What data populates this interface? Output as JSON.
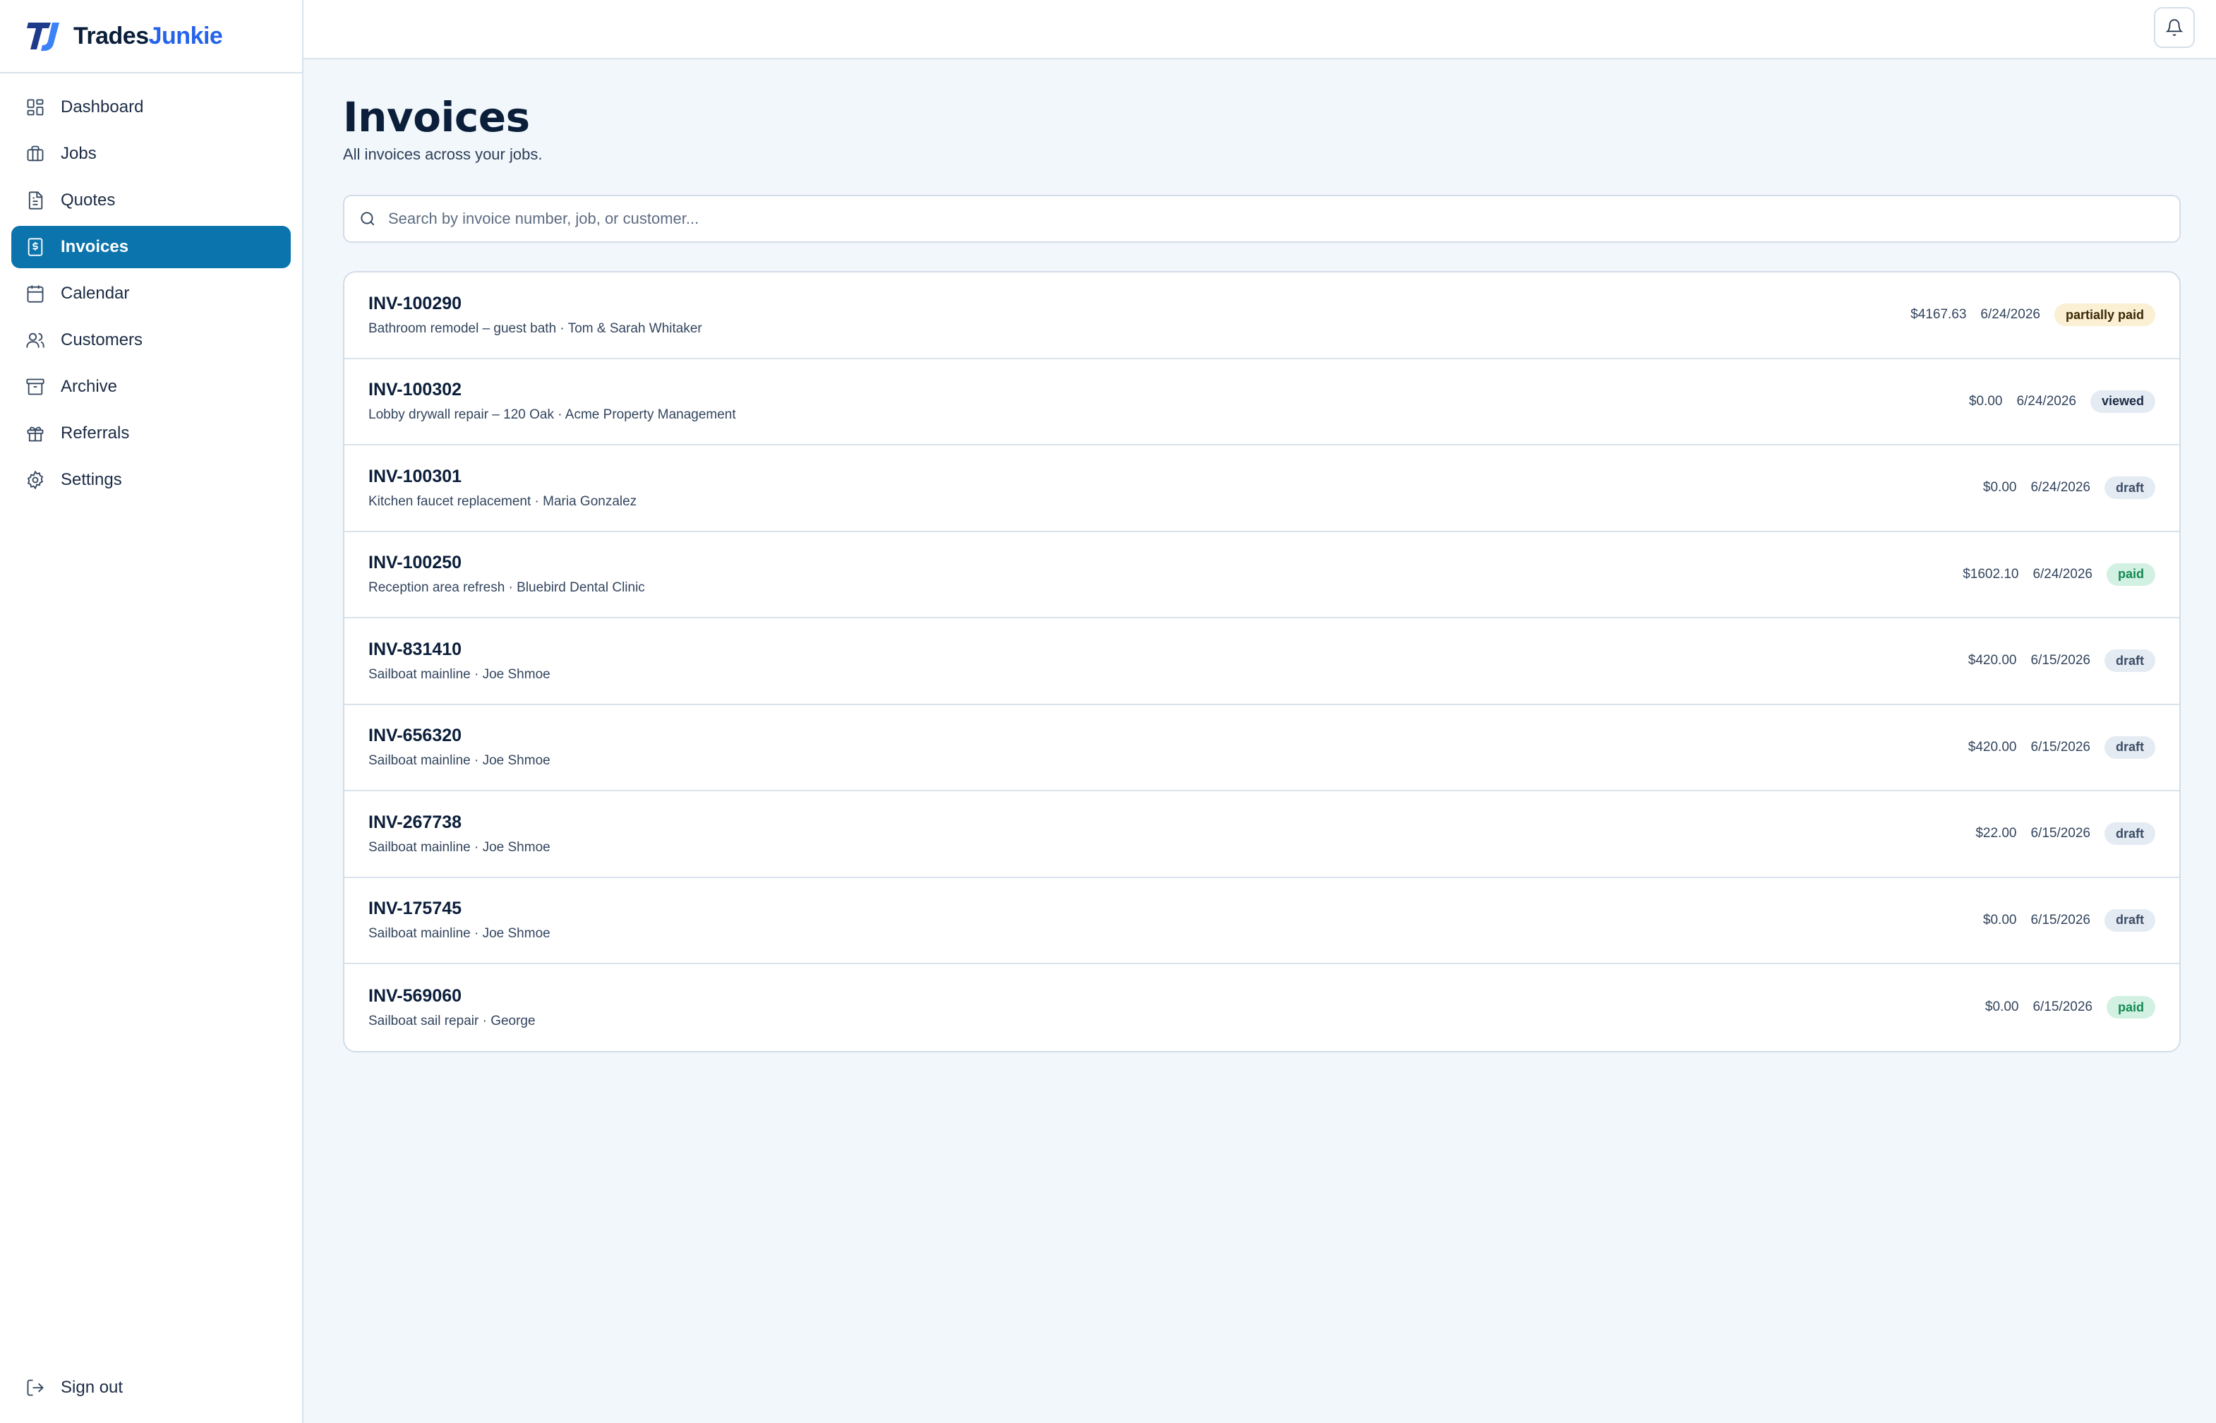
{
  "brand": {
    "name_part1": "Trades",
    "name_part2": "Junkie"
  },
  "nav": [
    {
      "label": "Dashboard",
      "icon": "dashboard-icon",
      "active": false
    },
    {
      "label": "Jobs",
      "icon": "briefcase-icon",
      "active": false
    },
    {
      "label": "Quotes",
      "icon": "document-icon",
      "active": false
    },
    {
      "label": "Invoices",
      "icon": "receipt-dollar-icon",
      "active": true
    },
    {
      "label": "Calendar",
      "icon": "calendar-icon",
      "active": false
    },
    {
      "label": "Customers",
      "icon": "users-icon",
      "active": false
    },
    {
      "label": "Archive",
      "icon": "archive-icon",
      "active": false
    },
    {
      "label": "Referrals",
      "icon": "gift-icon",
      "active": false
    },
    {
      "label": "Settings",
      "icon": "gear-icon",
      "active": false
    }
  ],
  "signout": {
    "label": "Sign out",
    "icon": "sign-out-icon"
  },
  "header": {
    "notification_icon": "bell-icon"
  },
  "page": {
    "title": "Invoices",
    "subtitle": "All invoices across your jobs."
  },
  "search": {
    "placeholder": "Search by invoice number, job, or customer...",
    "value": ""
  },
  "invoices": [
    {
      "number": "INV-100290",
      "desc": "Bathroom remodel – guest bath · Tom & Sarah Whitaker",
      "amount": "$4167.63",
      "date": "6/24/2026",
      "status": "partially paid",
      "status_key": "partially"
    },
    {
      "number": "INV-100302",
      "desc": "Lobby drywall repair – 120 Oak · Acme Property Management",
      "amount": "$0.00",
      "date": "6/24/2026",
      "status": "viewed",
      "status_key": "viewed"
    },
    {
      "number": "INV-100301",
      "desc": "Kitchen faucet replacement · Maria Gonzalez",
      "amount": "$0.00",
      "date": "6/24/2026",
      "status": "draft",
      "status_key": "draft"
    },
    {
      "number": "INV-100250",
      "desc": "Reception area refresh · Bluebird Dental Clinic",
      "amount": "$1602.10",
      "date": "6/24/2026",
      "status": "paid",
      "status_key": "paid"
    },
    {
      "number": "INV-831410",
      "desc": "Sailboat mainline · Joe Shmoe",
      "amount": "$420.00",
      "date": "6/15/2026",
      "status": "draft",
      "status_key": "draft"
    },
    {
      "number": "INV-656320",
      "desc": "Sailboat mainline · Joe Shmoe",
      "amount": "$420.00",
      "date": "6/15/2026",
      "status": "draft",
      "status_key": "draft"
    },
    {
      "number": "INV-267738",
      "desc": "Sailboat mainline · Joe Shmoe",
      "amount": "$22.00",
      "date": "6/15/2026",
      "status": "draft",
      "status_key": "draft"
    },
    {
      "number": "INV-175745",
      "desc": "Sailboat mainline · Joe Shmoe",
      "amount": "$0.00",
      "date": "6/15/2026",
      "status": "draft",
      "status_key": "draft"
    },
    {
      "number": "INV-569060",
      "desc": "Sailboat sail repair · George",
      "amount": "$0.00",
      "date": "6/15/2026",
      "status": "paid",
      "status_key": "paid"
    }
  ],
  "colors": {
    "accent": "#0c74ad",
    "brand_blue": "#2563eb",
    "navy": "#0b1e3a",
    "background": "#f1f7fb"
  }
}
